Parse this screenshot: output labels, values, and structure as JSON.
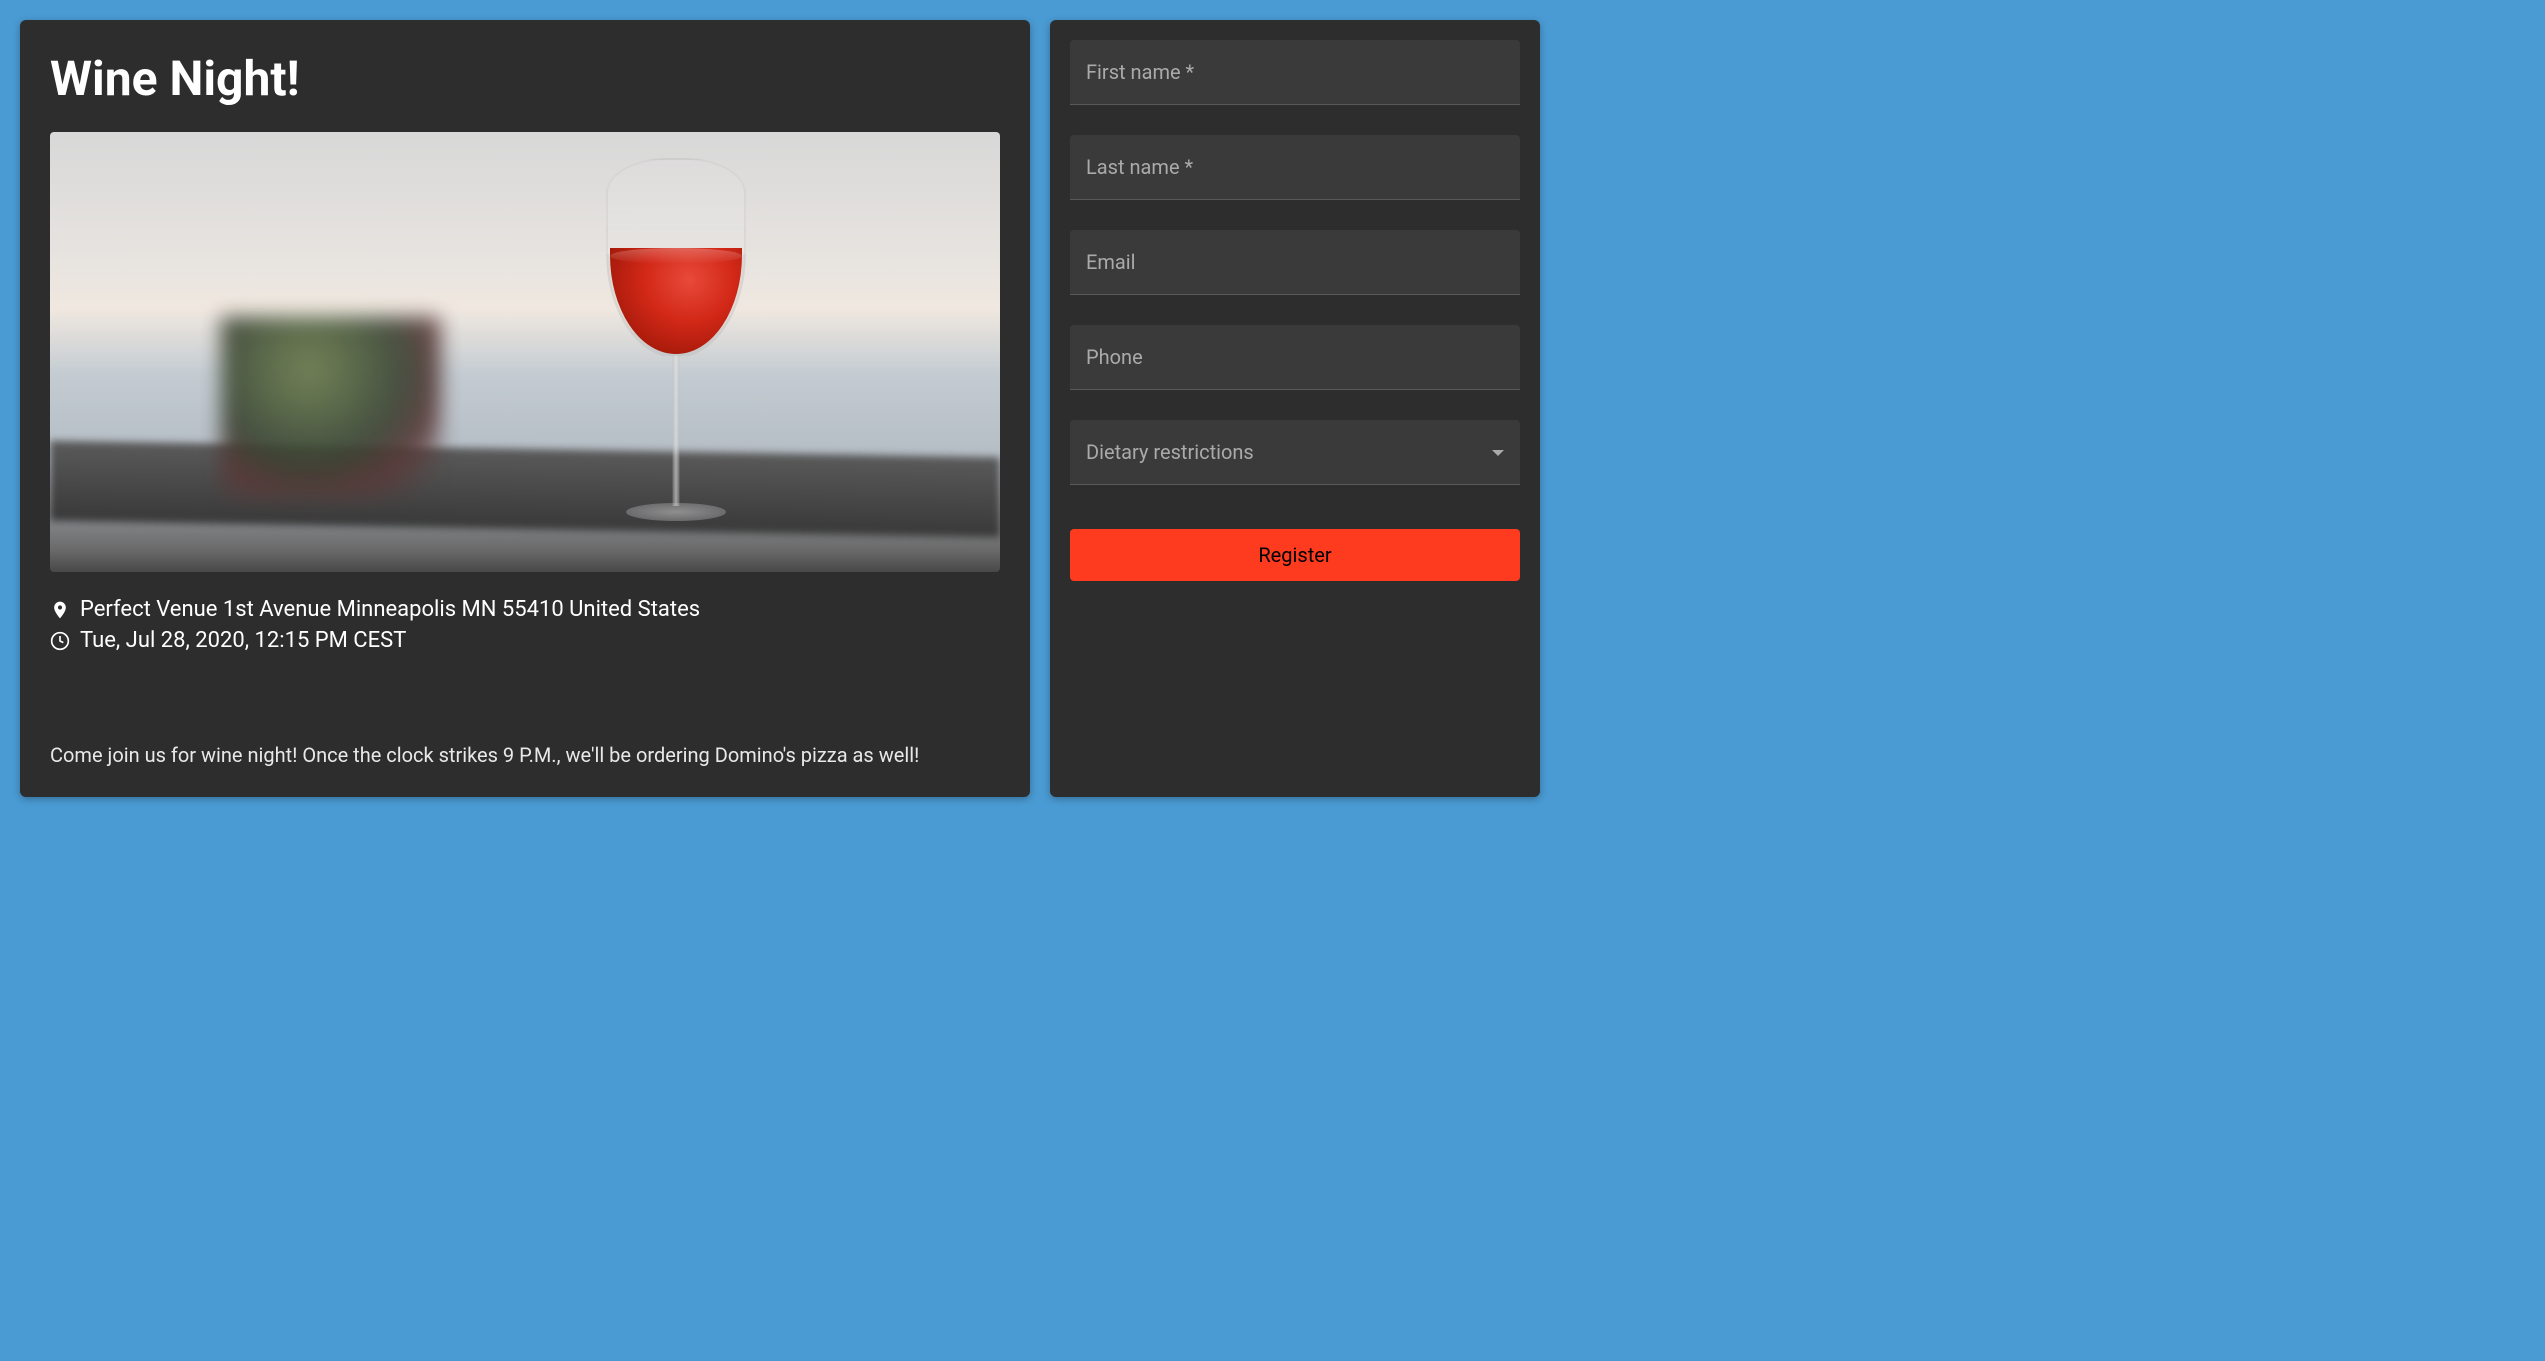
{
  "event": {
    "title": "Wine Night!",
    "location": "Perfect Venue 1st Avenue Minneapolis MN 55410 United States",
    "datetime": "Tue, Jul 28, 2020, 12:15 PM CEST",
    "description": "Come join us for wine night! Once the clock strikes 9 P.M., we'll be ordering Domino's pizza as well!"
  },
  "form": {
    "first_name_placeholder": "First name *",
    "last_name_placeholder": "Last name *",
    "email_placeholder": "Email",
    "phone_placeholder": "Phone",
    "dietary_placeholder": "Dietary restrictions",
    "submit_label": "Register"
  }
}
